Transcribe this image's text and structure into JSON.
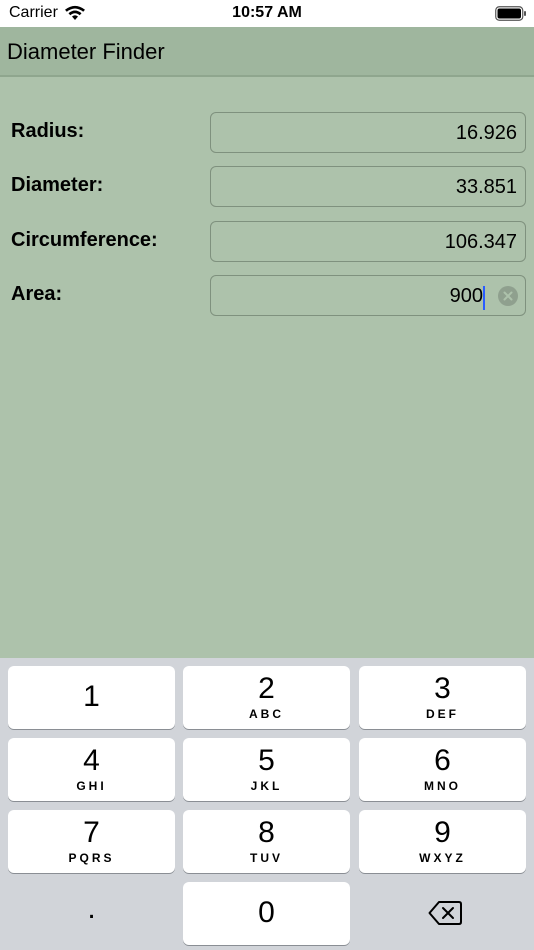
{
  "status_bar": {
    "carrier": "Carrier",
    "time": "10:57 AM"
  },
  "nav": {
    "title": "Diameter Finder"
  },
  "form": {
    "rows": [
      {
        "label": "Radius:",
        "value": "16.926"
      },
      {
        "label": "Diameter:",
        "value": "33.851"
      },
      {
        "label": "Circumference:",
        "value": "106.347"
      },
      {
        "label": "Area:",
        "value": "900"
      }
    ]
  },
  "keyboard": {
    "keys": [
      {
        "digit": "1",
        "letters": ""
      },
      {
        "digit": "2",
        "letters": "ABC"
      },
      {
        "digit": "3",
        "letters": "DEF"
      },
      {
        "digit": "4",
        "letters": "GHI"
      },
      {
        "digit": "5",
        "letters": "JKL"
      },
      {
        "digit": "6",
        "letters": "MNO"
      },
      {
        "digit": "7",
        "letters": "PQRS"
      },
      {
        "digit": "8",
        "letters": "TUV"
      },
      {
        "digit": "9",
        "letters": "WXYZ"
      },
      {
        "digit": "0",
        "letters": ""
      }
    ],
    "dot_label": ".",
    "delete_icon": "delete-backspace-icon"
  },
  "colors": {
    "background": "#adc2ab",
    "nav_background": "#9fb69e",
    "keyboard_background": "#d1d4d9",
    "cursor": "#2a5cff"
  }
}
